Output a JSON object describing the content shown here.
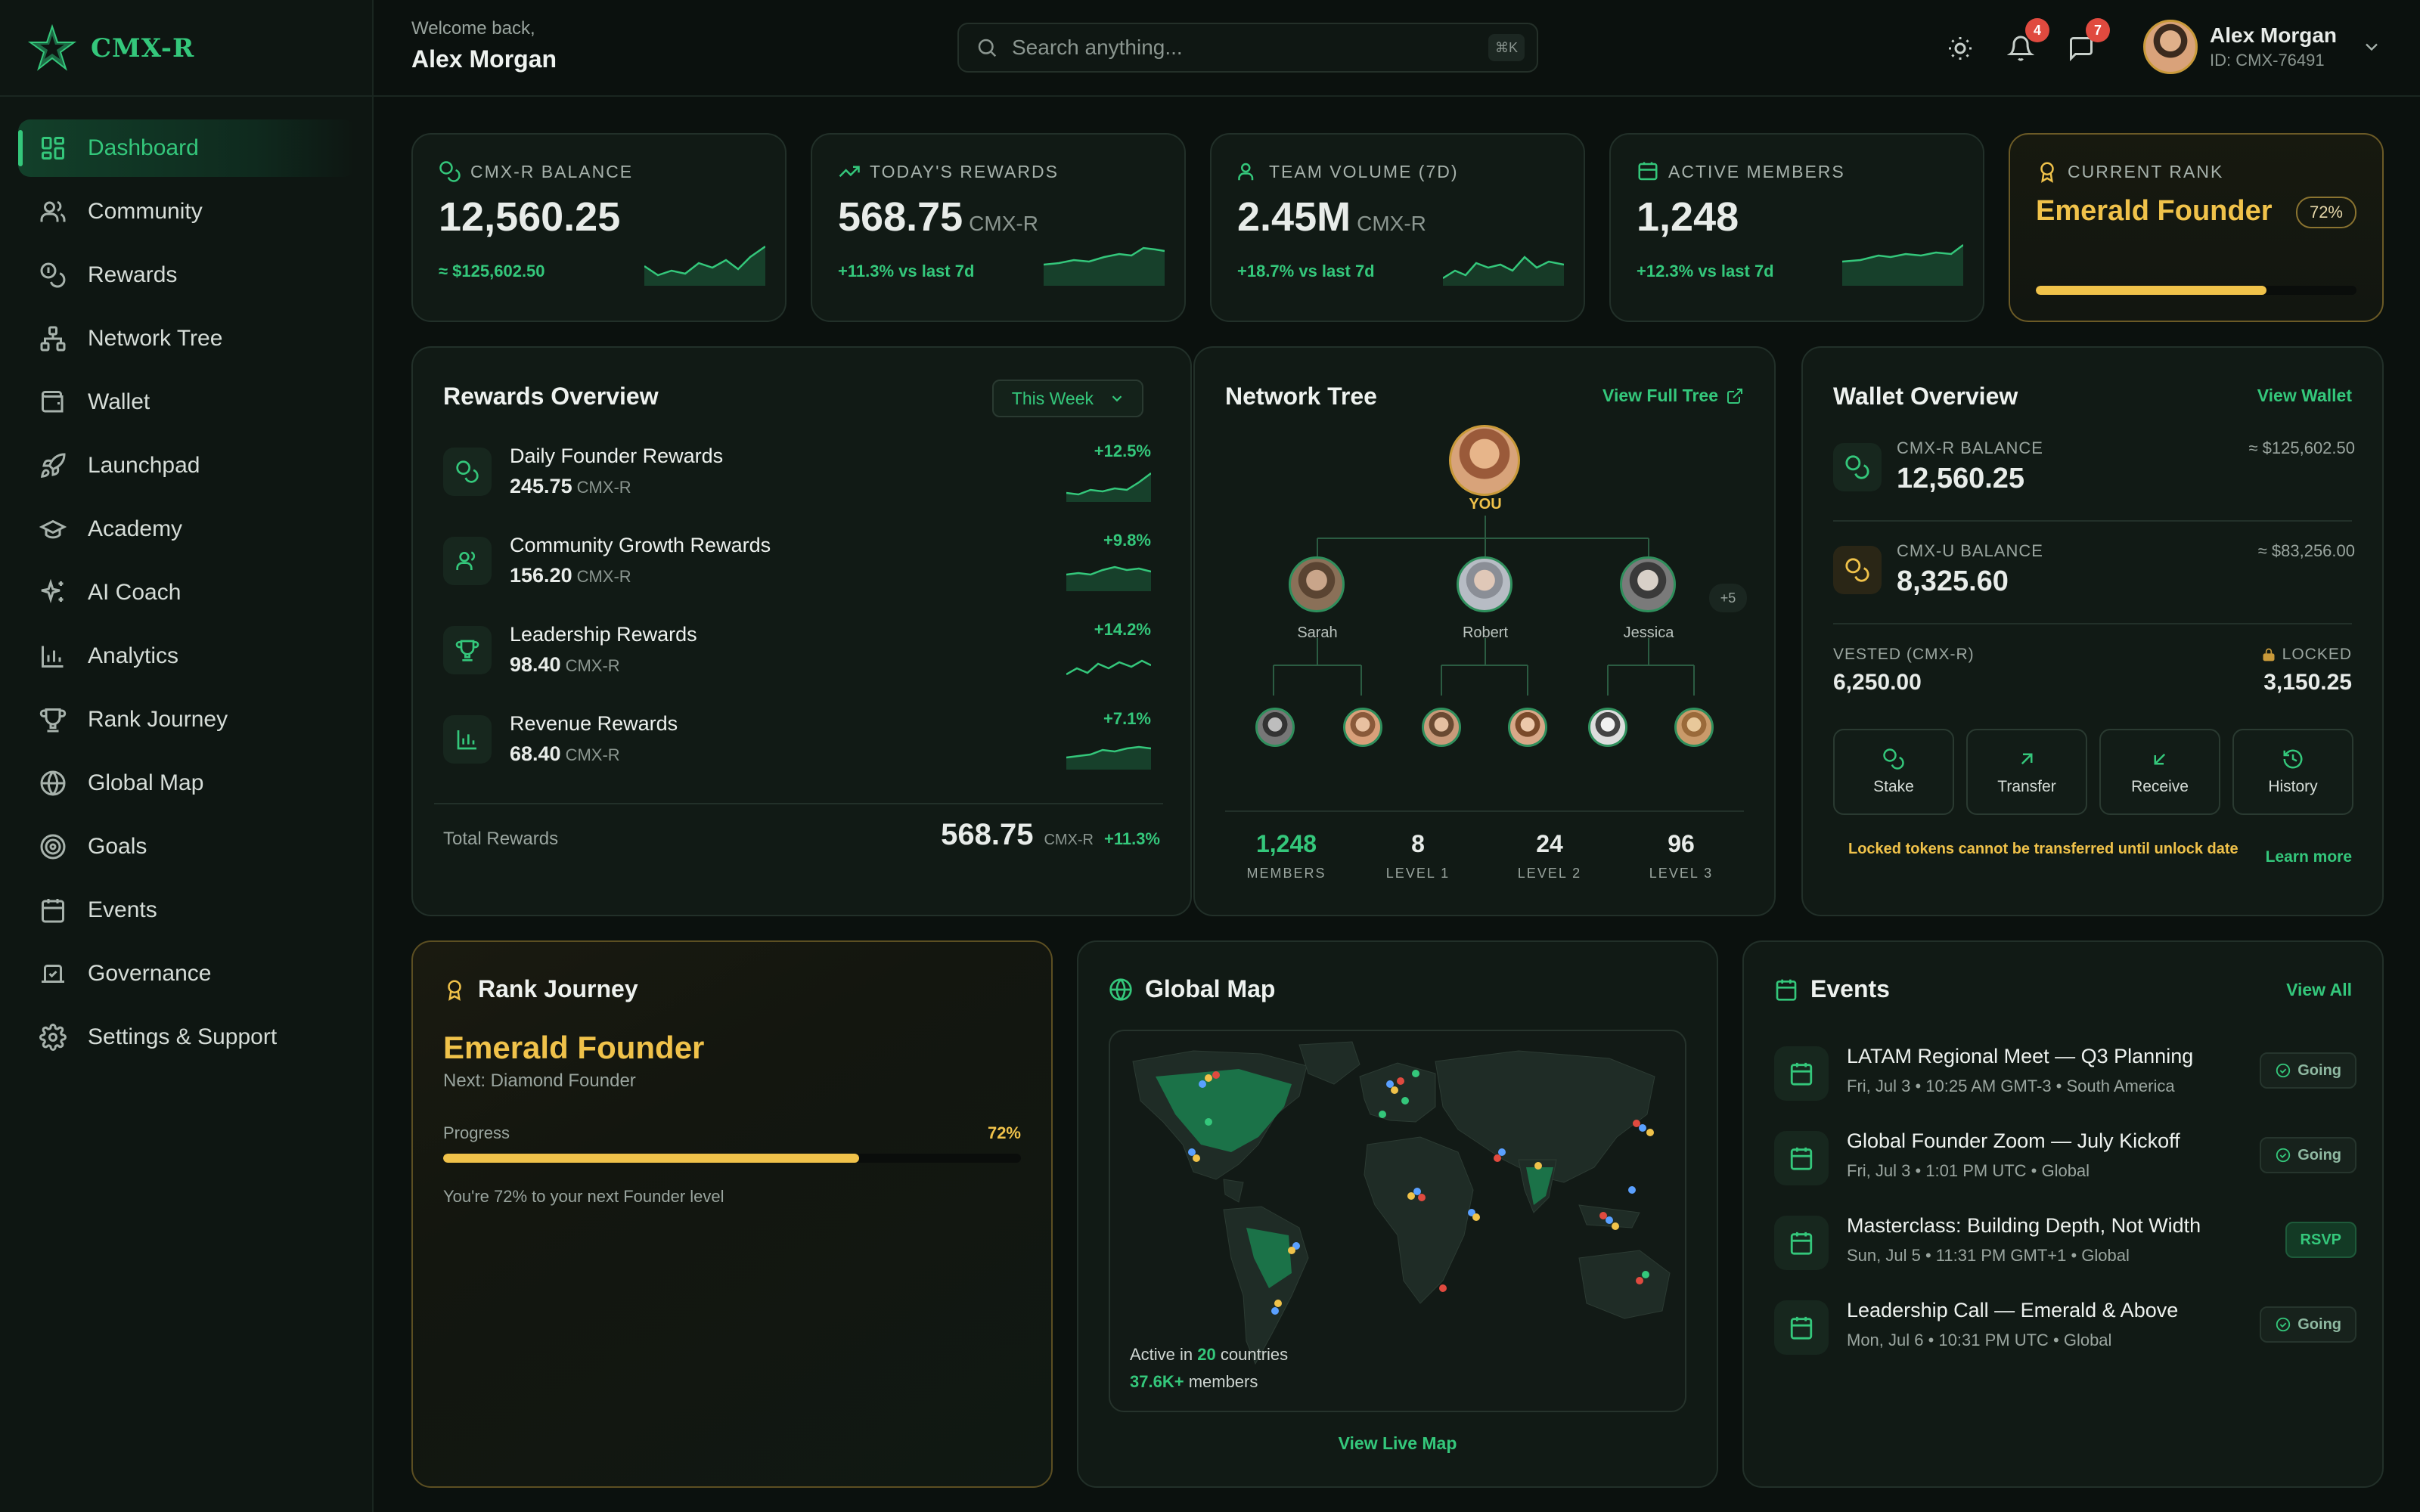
{
  "brand": {
    "name": "CMX-R"
  },
  "header": {
    "welcome": "Welcome back,",
    "user_name": "Alex Morgan",
    "search_placeholder": "Search anything...",
    "search_shortcut": "⌘K",
    "notifications_count": "4",
    "messages_count": "7",
    "user_id": "ID: CMX-76491"
  },
  "nav": [
    {
      "label": "Dashboard",
      "icon": "grid-icon",
      "active": true
    },
    {
      "label": "Community",
      "icon": "users-icon"
    },
    {
      "label": "Rewards",
      "icon": "coins-icon"
    },
    {
      "label": "Network Tree",
      "icon": "network-icon"
    },
    {
      "label": "Wallet",
      "icon": "wallet-icon"
    },
    {
      "label": "Launchpad",
      "icon": "rocket-icon"
    },
    {
      "label": "Academy",
      "icon": "graduation-cap-icon"
    },
    {
      "label": "AI Coach",
      "icon": "sparkles-icon"
    },
    {
      "label": "Analytics",
      "icon": "bar-chart-icon"
    },
    {
      "label": "Rank Journey",
      "icon": "trophy-icon"
    },
    {
      "label": "Global Map",
      "icon": "globe-icon"
    },
    {
      "label": "Goals",
      "icon": "target-icon"
    },
    {
      "label": "Events",
      "icon": "calendar-icon"
    },
    {
      "label": "Governance",
      "icon": "vote-icon"
    },
    {
      "label": "Settings & Support",
      "icon": "gear-icon"
    }
  ],
  "stats": [
    {
      "label": "CMX-R BALANCE",
      "value": "12,560.25",
      "unit": "",
      "delta": "≈ $125,602.50"
    },
    {
      "label": "TODAY'S REWARDS",
      "value": "568.75",
      "unit": "CMX-R",
      "delta": "+11.3% vs last 7d"
    },
    {
      "label": "TEAM VOLUME (7D)",
      "value": "2.45M",
      "unit": "CMX-R",
      "delta": "+18.7% vs last 7d"
    },
    {
      "label": "ACTIVE MEMBERS",
      "value": "1,248",
      "unit": "",
      "delta": "+12.3% vs last 7d"
    }
  ],
  "rank_card": {
    "label": "CURRENT RANK",
    "rank": "Emerald Founder",
    "percent": "72%",
    "progress": 0.72
  },
  "rewards": {
    "title": "Rewards Overview",
    "period": "This Week",
    "items": [
      {
        "name": "Daily Founder Rewards",
        "value": "245.75",
        "unit": "CMX-R",
        "delta": "+12.5%"
      },
      {
        "name": "Community Growth Rewards",
        "value": "156.20",
        "unit": "CMX-R",
        "delta": "+9.8%"
      },
      {
        "name": "Leadership Rewards",
        "value": "98.40",
        "unit": "CMX-R",
        "delta": "+14.2%"
      },
      {
        "name": "Revenue Rewards",
        "value": "68.40",
        "unit": "CMX-R",
        "delta": "+7.1%"
      }
    ],
    "total_label": "Total Rewards",
    "total_value": "568.75",
    "total_unit": "CMX-R",
    "total_delta": "+11.3%"
  },
  "network": {
    "title": "Network Tree",
    "link": "View Full Tree",
    "you": "YOU",
    "level1": [
      "Sarah",
      "Robert",
      "Jessica"
    ],
    "more": "+5",
    "stats": [
      {
        "value": "1,248",
        "label": "MEMBERS"
      },
      {
        "value": "8",
        "label": "LEVEL 1"
      },
      {
        "value": "24",
        "label": "LEVEL 2"
      },
      {
        "value": "96",
        "label": "LEVEL 3"
      }
    ]
  },
  "wallet": {
    "title": "Wallet Overview",
    "link": "View Wallet",
    "cmxr_label": "CMX-R BALANCE",
    "cmxr_value": "12,560.25",
    "cmxr_usd": "≈ $125,602.50",
    "cmxu_label": "CMX-U BALANCE",
    "cmxu_value": "8,325.60",
    "cmxu_usd": "≈ $83,256.00",
    "vested_label": "VESTED (CMX-R)",
    "vested_value": "6,250.00",
    "locked_label": "LOCKED",
    "locked_value": "3,150.25",
    "actions": [
      "Stake",
      "Transfer",
      "Receive",
      "History"
    ],
    "note": "Locked tokens cannot be transferred until unlock date",
    "learn_more": "Learn more"
  },
  "rank_journey": {
    "title": "Rank Journey",
    "rank": "Emerald Founder",
    "next": "Next: Diamond Founder",
    "progress_label": "Progress",
    "progress_pct": "72%",
    "progress": 0.72,
    "note": "You're 72% to your next Founder level"
  },
  "global_map": {
    "title": "Global Map",
    "active_prefix": "Active in",
    "countries": "20",
    "countries_suffix": "countries",
    "members": "37.6K+",
    "members_suffix": "members",
    "link": "View Live Map"
  },
  "events": {
    "title": "Events",
    "link": "View All",
    "items": [
      {
        "title": "LATAM Regional Meet — Q3 Planning",
        "meta": "Fri, Jul 3 • 10:25 AM GMT-3 • South America",
        "status": "Going"
      },
      {
        "title": "Global Founder Zoom — July Kickoff",
        "meta": "Fri, Jul 3 • 1:01 PM UTC • Global",
        "status": "Going"
      },
      {
        "title": "Masterclass: Building Depth, Not Width",
        "meta": "Sun, Jul 5 • 11:31 PM GMT+1 • Global",
        "status": "RSVP"
      },
      {
        "title": "Leadership Call — Emerald & Above",
        "meta": "Mon, Jul 6 • 10:31 PM UTC • Global",
        "status": "Going"
      }
    ]
  },
  "colors": {
    "accent": "#34c77b",
    "gold": "#f0c24a",
    "bg": "#0b110e",
    "card": "#111a15"
  }
}
